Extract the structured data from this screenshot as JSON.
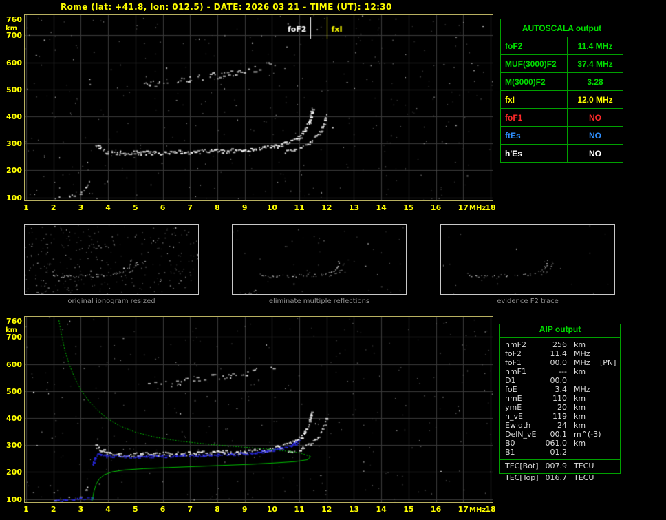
{
  "header": {
    "title": "Rome (lat: +41.8, lon: 012.5) - DATE: 2026 03 21 - TIME (UT): 12:30"
  },
  "autoscala_table": {
    "title": "AUTOSCALA output",
    "rows": [
      {
        "label": "foF2",
        "value": "11.4 MHz",
        "color": "#00dd00"
      },
      {
        "label": "MUF(3000)F2",
        "value": "37.4 MHz",
        "color": "#00dd00"
      },
      {
        "label": "M(3000)F2",
        "value": "3.28",
        "color": "#00dd00"
      },
      {
        "label": "fxI",
        "value": "12.0 MHz",
        "color": "#ffff00"
      },
      {
        "label": "foF1",
        "value": "NO",
        "color": "#ff2a2a"
      },
      {
        "label": "ftEs",
        "value": "NO",
        "color": "#2f8fff"
      },
      {
        "label": "h'Es",
        "value": "NO",
        "color": "#ffffff"
      }
    ]
  },
  "aip_table": {
    "title": "AIP output",
    "rows": [
      {
        "label": "hmF2",
        "value": "256",
        "unit": "km",
        "note": ""
      },
      {
        "label": "foF2",
        "value": "11.4",
        "unit": "MHz",
        "note": ""
      },
      {
        "label": "foF1",
        "value": "00.0",
        "unit": "MHz",
        "note": "[PN]"
      },
      {
        "label": "hmF1",
        "value": "---",
        "unit": "km",
        "note": ""
      },
      {
        "label": "D1",
        "value": "00.0",
        "unit": "",
        "note": ""
      },
      {
        "label": "foE",
        "value": "3.4",
        "unit": "MHz",
        "note": ""
      },
      {
        "label": "hmE",
        "value": "110",
        "unit": "km",
        "note": ""
      },
      {
        "label": "ymE",
        "value": "20",
        "unit": "km",
        "note": ""
      },
      {
        "label": "h_vE",
        "value": "119",
        "unit": "km",
        "note": ""
      },
      {
        "label": "Ewidth",
        "value": "24",
        "unit": "km",
        "note": ""
      },
      {
        "label": "DelN_vE",
        "value": "00.1",
        "unit": "m^(-3)",
        "note": ""
      },
      {
        "label": "B0",
        "value": "061.0",
        "unit": "km",
        "note": ""
      },
      {
        "label": "B1",
        "value": "01.2",
        "unit": "",
        "note": ""
      }
    ],
    "tec_rows": [
      {
        "label": "TEC[Bot]",
        "value": "007.9",
        "unit": "TECU"
      },
      {
        "label": "TEC[Top]",
        "value": "016.7",
        "unit": "TECU"
      }
    ]
  },
  "thumbnails": {
    "items": [
      {
        "caption": "original ionogram resized",
        "use_series": [
          "E-region-echo",
          "F-trace-ordinary",
          "F-trace-extraordinary",
          "second-hop-echo"
        ],
        "noise": 280,
        "density_scale": 0.8
      },
      {
        "caption": "eliminate multiple reflections",
        "use_series": [
          "E-region-echo",
          "F-trace-ordinary",
          "F-trace-extraordinary"
        ],
        "noise": 45,
        "density_scale": 0.7
      },
      {
        "caption": "evidence F2 trace",
        "use_series": [
          "F-trace-ordinary",
          "F-trace-extraordinary"
        ],
        "noise": 20,
        "density_scale": 0.45
      }
    ]
  },
  "chart_data": [
    {
      "id": "top_ionogram",
      "type": "scatter",
      "title": "",
      "xlabel": "MHz",
      "ylabel": "km",
      "xlim": [
        1,
        18
      ],
      "ylim": [
        89,
        775
      ],
      "xticks": [
        1,
        2,
        3,
        4,
        5,
        6,
        7,
        8,
        9,
        10,
        11,
        12,
        13,
        14,
        15,
        16,
        17,
        18
      ],
      "yticks": [
        100,
        200,
        300,
        400,
        500,
        600,
        700,
        760
      ],
      "grid": true,
      "markers": [
        {
          "label": "foF2",
          "x_mhz": 11.4,
          "color": "#ffffff",
          "label_side": "left"
        },
        {
          "label": "fxI",
          "x_mhz": 12.0,
          "color": "#ffff00",
          "label_side": "right"
        }
      ],
      "series": [
        {
          "name": "E-region-echo",
          "color": "#e8e8e8",
          "density": 0.45,
          "size": 2,
          "jitter": 3,
          "points": [
            [
              2.05,
              100
            ],
            [
              2.3,
              102
            ],
            [
              2.55,
              105
            ],
            [
              2.8,
              109
            ],
            [
              3.0,
              118
            ],
            [
              3.15,
              135
            ],
            [
              3.28,
              155
            ]
          ]
        },
        {
          "name": "F-trace-ordinary",
          "color": "#ffffff",
          "density": 0.92,
          "size": 2,
          "jitter": 3,
          "points": [
            [
              3.55,
              299
            ],
            [
              3.7,
              281
            ],
            [
              3.95,
              271
            ],
            [
              4.4,
              266
            ],
            [
              5.2,
              267
            ],
            [
              6.2,
              269
            ],
            [
              7.2,
              271
            ],
            [
              8.2,
              274
            ],
            [
              9.0,
              278
            ],
            [
              9.7,
              284
            ],
            [
              10.2,
              293
            ],
            [
              10.6,
              305
            ],
            [
              10.95,
              322
            ],
            [
              11.18,
              347
            ],
            [
              11.32,
              378
            ],
            [
              11.4,
              405
            ],
            [
              11.45,
              428
            ]
          ]
        },
        {
          "name": "F-trace-extraordinary",
          "color": "#f0f0f0",
          "density": 0.75,
          "size": 2,
          "jitter": 2,
          "points": [
            [
              10.45,
              271
            ],
            [
              10.8,
              279
            ],
            [
              11.1,
              290
            ],
            [
              11.4,
              308
            ],
            [
              11.65,
              333
            ],
            [
              11.85,
              365
            ],
            [
              11.97,
              405
            ]
          ]
        },
        {
          "name": "second-hop-echo",
          "color": "#d8d8d8",
          "density": 0.38,
          "size": 2,
          "jitter": 5,
          "points": [
            [
              5.3,
              521
            ],
            [
              6.1,
              528
            ],
            [
              6.9,
              538
            ],
            [
              7.7,
              550
            ],
            [
              8.4,
              561
            ],
            [
              9.1,
              573
            ],
            [
              9.7,
              586
            ],
            [
              10.1,
              598
            ]
          ]
        }
      ],
      "noise": {
        "count": 380,
        "color": "#aaaaaa"
      }
    },
    {
      "id": "bottom_ionogram",
      "type": "scatter",
      "title": "",
      "xlabel": "MHz",
      "ylabel": "km",
      "xlim": [
        1,
        18
      ],
      "ylim": [
        89,
        775
      ],
      "xticks": [
        1,
        2,
        3,
        4,
        5,
        6,
        7,
        8,
        9,
        10,
        11,
        12,
        13,
        14,
        15,
        16,
        17,
        18
      ],
      "yticks": [
        100,
        200,
        300,
        400,
        500,
        600,
        700,
        760
      ],
      "grid": true,
      "markers": [],
      "series": [
        {
          "name": "E-region-echo",
          "color": "#e8e8e8",
          "density": 0.35,
          "size": 2,
          "jitter": 3,
          "points": [
            [
              2.05,
              100
            ],
            [
              2.3,
              102
            ],
            [
              2.55,
              105
            ],
            [
              2.8,
              109
            ],
            [
              3.0,
              118
            ],
            [
              3.15,
              135
            ],
            [
              3.28,
              155
            ]
          ]
        },
        {
          "name": "F-trace-ordinary",
          "color": "#ffffff",
          "density": 0.9,
          "size": 2,
          "jitter": 3,
          "points": [
            [
              3.55,
              299
            ],
            [
              3.7,
              281
            ],
            [
              3.95,
              271
            ],
            [
              4.4,
              266
            ],
            [
              5.2,
              267
            ],
            [
              6.2,
              269
            ],
            [
              7.2,
              271
            ],
            [
              8.2,
              274
            ],
            [
              9.0,
              278
            ],
            [
              9.7,
              284
            ],
            [
              10.2,
              293
            ],
            [
              10.6,
              305
            ],
            [
              10.95,
              322
            ],
            [
              11.18,
              347
            ],
            [
              11.32,
              378
            ],
            [
              11.4,
              405
            ],
            [
              11.45,
              428
            ]
          ]
        },
        {
          "name": "F-trace-extraordinary",
          "color": "#f0f0f0",
          "density": 0.7,
          "size": 2,
          "jitter": 2,
          "points": [
            [
              10.45,
              271
            ],
            [
              10.8,
              279
            ],
            [
              11.1,
              290
            ],
            [
              11.4,
              308
            ],
            [
              11.65,
              333
            ],
            [
              11.85,
              365
            ],
            [
              11.97,
              405
            ]
          ]
        },
        {
          "name": "second-hop-echo",
          "color": "#d8d8d8",
          "density": 0.35,
          "size": 2,
          "jitter": 5,
          "points": [
            [
              5.3,
              521
            ],
            [
              6.1,
              528
            ],
            [
              6.9,
              538
            ],
            [
              7.7,
              550
            ],
            [
              8.4,
              561
            ],
            [
              9.1,
              573
            ],
            [
              9.7,
              586
            ],
            [
              10.1,
              598
            ]
          ]
        },
        {
          "name": "scaled-F-trace",
          "color": "#2a2aee",
          "density": 0.95,
          "size": 2,
          "jitter": 2,
          "points": [
            [
              3.6,
              268
            ],
            [
              3.75,
              263
            ],
            [
              4.1,
              260
            ],
            [
              4.7,
              259
            ],
            [
              5.5,
              260
            ],
            [
              6.5,
              262
            ],
            [
              7.5,
              265
            ],
            [
              8.5,
              268
            ],
            [
              9.2,
              272
            ],
            [
              9.8,
              279
            ],
            [
              10.3,
              288
            ],
            [
              10.7,
              301
            ],
            [
              11.0,
              318
            ]
          ]
        },
        {
          "name": "scaled-E-trace",
          "color": "#2a2aee",
          "density": 0.6,
          "size": 2,
          "jitter": 2,
          "points": [
            [
              1.9,
              96
            ],
            [
              2.3,
              98
            ],
            [
              2.7,
              100
            ],
            [
              3.1,
              103
            ],
            [
              3.45,
              105
            ]
          ]
        },
        {
          "name": "scaled-valley-segment",
          "color": "#2a2aee",
          "density": 0.85,
          "size": 2,
          "jitter": 2,
          "points": [
            [
              3.42,
              230
            ],
            [
              3.46,
              244
            ],
            [
              3.52,
              258
            ],
            [
              3.58,
              266
            ]
          ]
        }
      ],
      "profile": {
        "color": "#00c000",
        "topside_dashed": [
          [
            2.2,
            762
          ],
          [
            2.3,
            705
          ],
          [
            2.42,
            650
          ],
          [
            2.58,
            598
          ],
          [
            2.78,
            548
          ],
          [
            3.0,
            505
          ],
          [
            3.28,
            465
          ],
          [
            3.6,
            430
          ],
          [
            3.98,
            398
          ],
          [
            4.45,
            370
          ],
          [
            5.0,
            348
          ],
          [
            5.7,
            330
          ],
          [
            6.6,
            315
          ],
          [
            7.7,
            303
          ],
          [
            8.9,
            293
          ],
          [
            10.0,
            284
          ],
          [
            11.0,
            272
          ],
          [
            11.42,
            258
          ]
        ],
        "bottomside": [
          [
            11.42,
            258
          ],
          [
            11.3,
            246
          ],
          [
            10.85,
            239
          ],
          [
            10.1,
            234
          ],
          [
            9.2,
            229
          ],
          [
            8.2,
            225
          ],
          [
            7.2,
            221
          ],
          [
            6.2,
            217
          ],
          [
            5.3,
            213
          ],
          [
            4.6,
            208
          ],
          [
            4.15,
            201
          ],
          [
            3.85,
            190
          ],
          [
            3.67,
            174
          ],
          [
            3.56,
            154
          ],
          [
            3.49,
            132
          ],
          [
            3.45,
            112
          ],
          [
            3.42,
            94
          ]
        ]
      },
      "noise": {
        "count": 320,
        "color": "#aaaaaa"
      }
    }
  ]
}
